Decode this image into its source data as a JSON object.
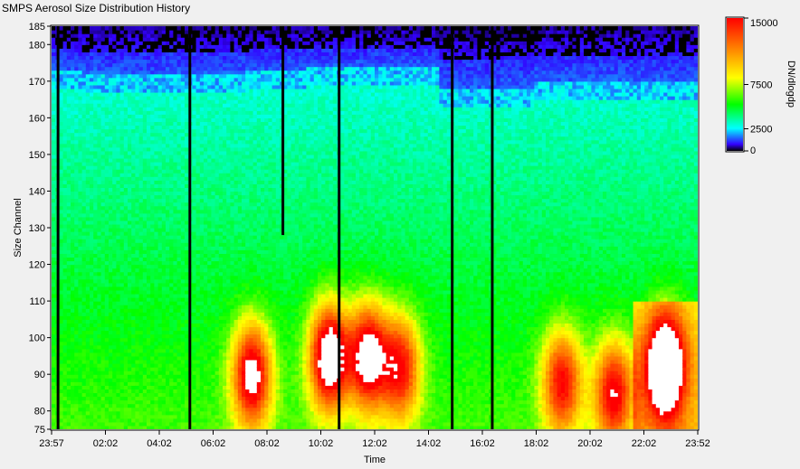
{
  "window": {
    "title": "SMPS Aerosol Size Distribution History"
  },
  "chart_data": {
    "type": "heatmap",
    "title": "",
    "xlabel": "Time",
    "ylabel": "Size Channel",
    "colorbar_label": "DN/dlogdp",
    "x_ticks": [
      "23:57",
      "02:02",
      "04:02",
      "06:02",
      "08:02",
      "10:02",
      "12:02",
      "14:02",
      "16:02",
      "18:02",
      "20:02",
      "22:02",
      "23:52"
    ],
    "y_ticks": [
      75,
      80,
      90,
      100,
      110,
      120,
      130,
      140,
      150,
      160,
      170,
      180,
      185
    ],
    "ylim": [
      75,
      185
    ],
    "colorbar_ticks": [
      0,
      2500,
      7500,
      15000
    ],
    "colorbar_tick_labels": [
      "0",
      "2500",
      "7500",
      "15000"
    ],
    "colorbar_range": [
      0,
      15000
    ],
    "colorscale": [
      "#000000",
      "#3300ff",
      "#00ffff",
      "#00ff00",
      "#ffff00",
      "#ff0000"
    ],
    "saturated_color": "#ffffff",
    "grid": false,
    "data_gaps_x_fraction": [
      0.01,
      0.214,
      0.445,
      0.62,
      0.682
    ],
    "partial_gap": {
      "x_fraction": 0.358,
      "y_from": 128,
      "y_to": 185
    },
    "high_concentration_events": [
      {
        "x_center": 0.31,
        "y_center": 90,
        "intensity": 0.85
      },
      {
        "x_center": 0.43,
        "y_center": 95,
        "intensity": 1.0
      },
      {
        "x_center": 0.49,
        "y_center": 95,
        "intensity": 0.9
      },
      {
        "x_center": 0.54,
        "y_center": 92,
        "intensity": 0.7
      },
      {
        "x_center": 0.79,
        "y_center": 88,
        "intensity": 0.7
      },
      {
        "x_center": 0.87,
        "y_center": 85,
        "intensity": 0.75
      },
      {
        "x_center": 0.95,
        "y_center": 92,
        "intensity": 1.0
      }
    ]
  }
}
